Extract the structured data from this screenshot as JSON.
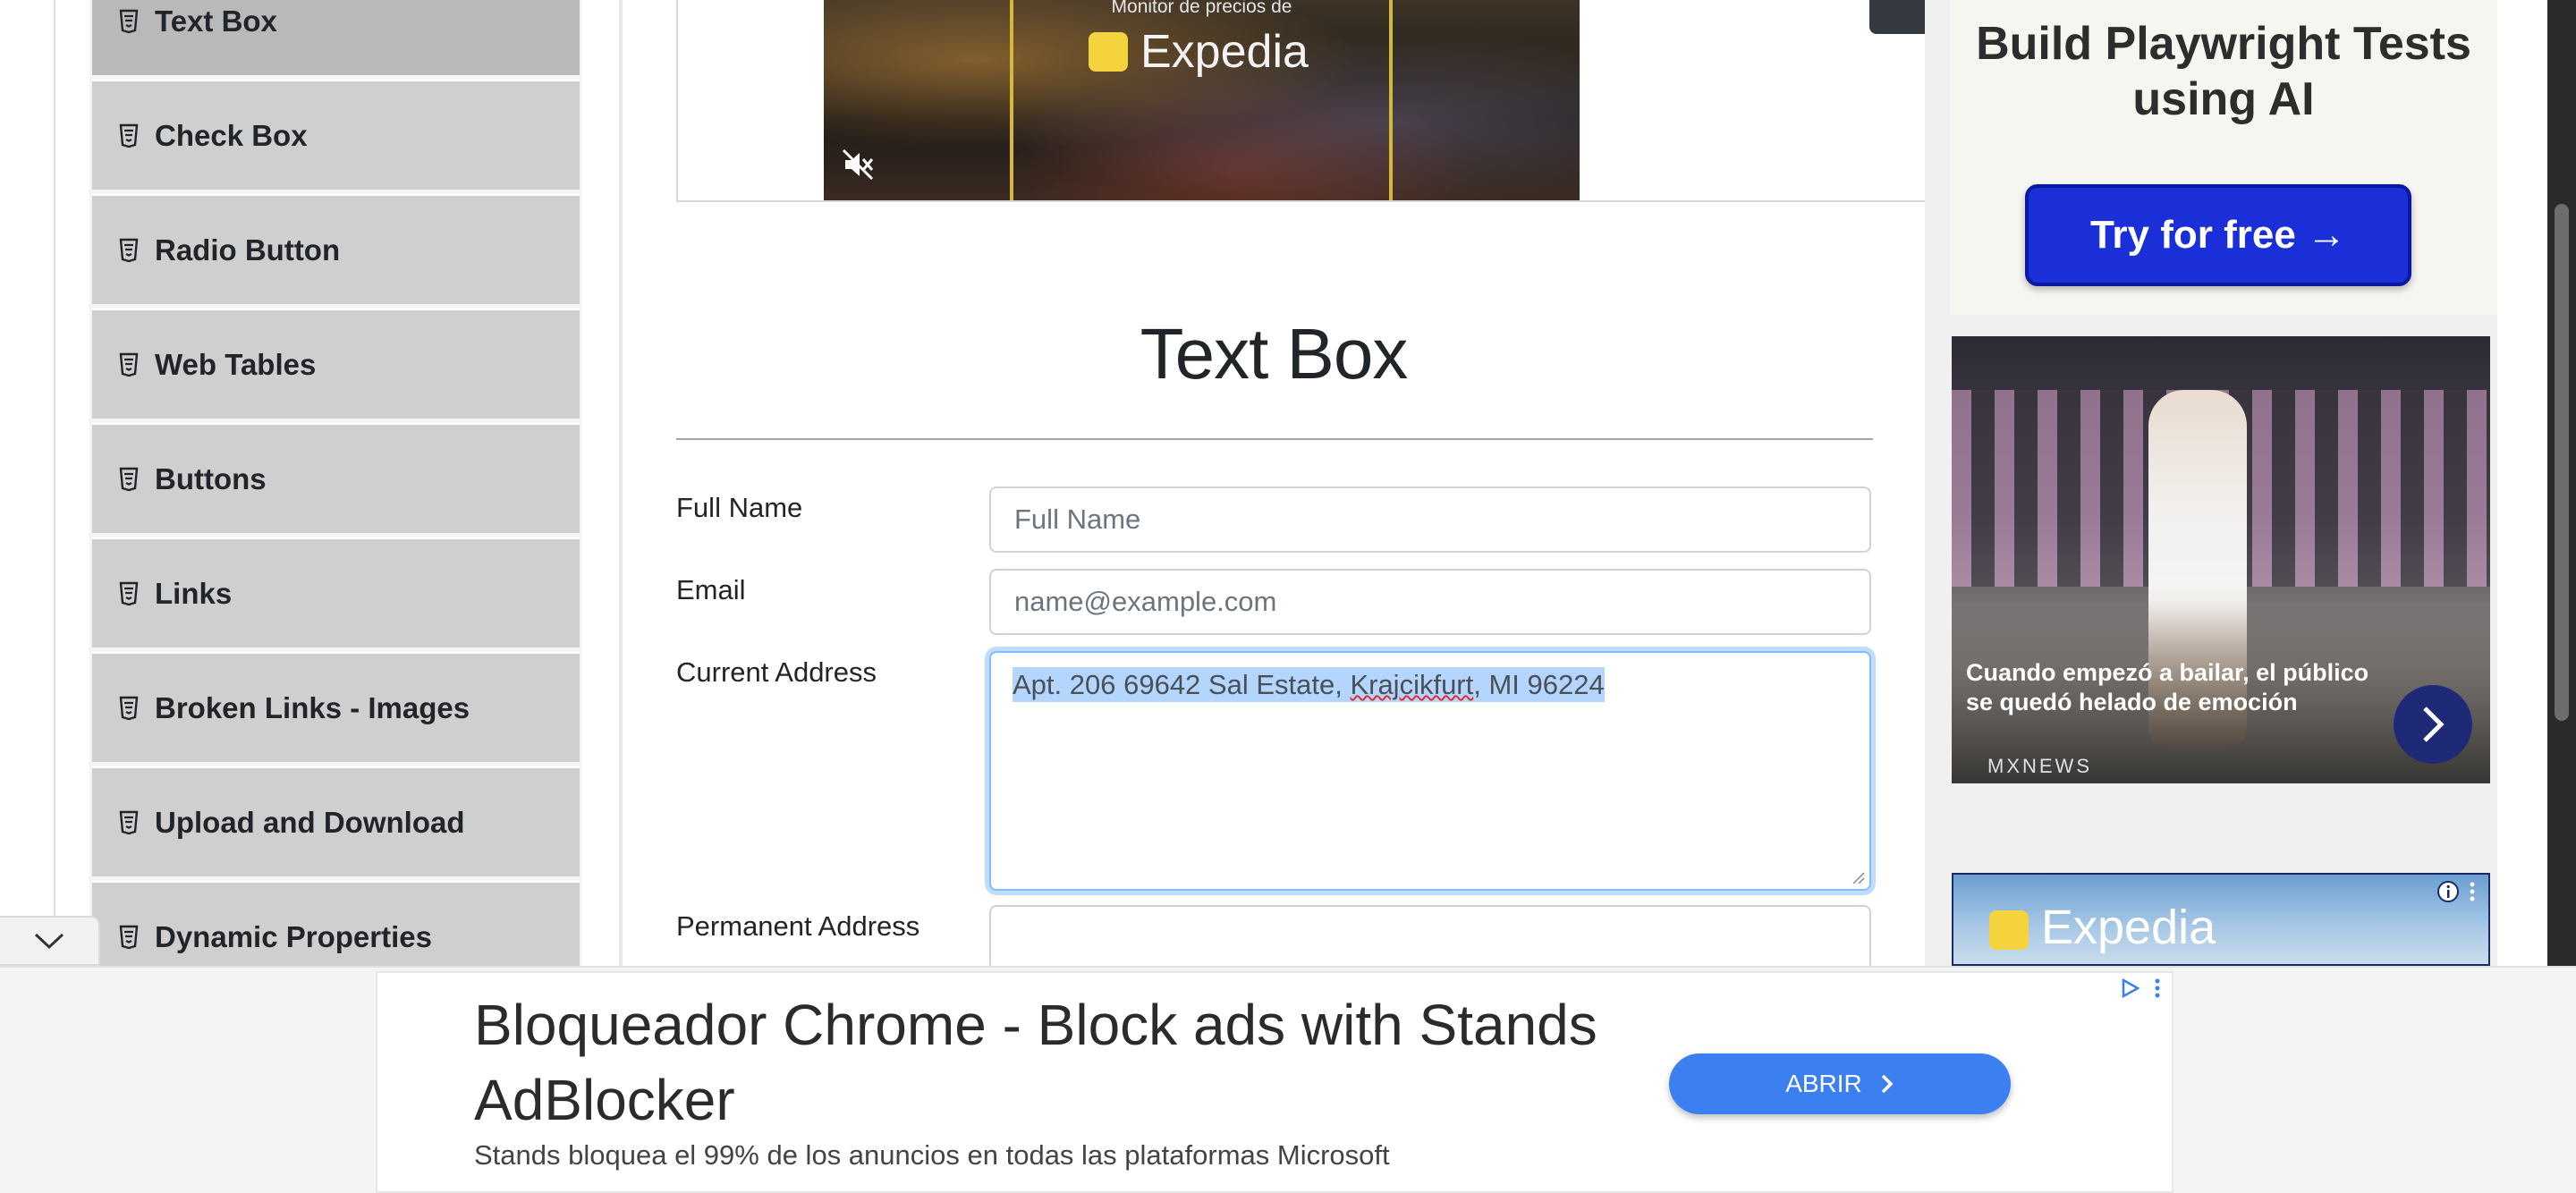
{
  "sidebar": {
    "items": [
      {
        "label": "Text Box",
        "active": true
      },
      {
        "label": "Check Box"
      },
      {
        "label": "Radio Button"
      },
      {
        "label": "Web Tables"
      },
      {
        "label": "Buttons"
      },
      {
        "label": "Links"
      },
      {
        "label": "Broken Links - Images"
      },
      {
        "label": "Upload and Download"
      },
      {
        "label": "Dynamic Properties"
      }
    ],
    "item_icon": "html5-file-icon",
    "collapse_icon": "chevron-down-icon"
  },
  "video_ad": {
    "top_text": "Monitor de precios de",
    "brand": "Expedia",
    "mute_icon": "muted-speaker-icon"
  },
  "main": {
    "header": "Text Box",
    "fields": {
      "full_name": {
        "label": "Full Name",
        "placeholder": "Full Name"
      },
      "email": {
        "label": "Email",
        "placeholder": "name@example.com"
      },
      "current_address": {
        "label": "Current Address",
        "value_part1": "Apt. 206 69642 Sal Estate, ",
        "value_misspelled": "Krajcikfurt",
        "value_part2": ", MI 96224"
      },
      "permanent_address": {
        "label": "Permanent Address"
      }
    }
  },
  "right_ads": {
    "ad1": {
      "title": "Build Playwright Tests using AI",
      "button": "Try for free →"
    },
    "ad2": {
      "caption": "Cuando empezó a bailar, el público se quedó helado de emoción",
      "source": "MXNEWS",
      "next_icon": "chevron-right-icon"
    },
    "ad3": {
      "brand": "Expedia"
    }
  },
  "bottom_banner": {
    "headline": "Bloqueador Chrome - Block ads with Stands AdBlocker",
    "subtext": "Stands bloquea el 99% de los anuncios en todas las plataformas Microsoft",
    "cta": "ABRIR"
  },
  "colors": {
    "sidebar_item": "#cfcfcf",
    "sidebar_active": "#b9b9b9",
    "focus_border": "#80bdff",
    "selection": "#b4d5fe",
    "cta_blue": "#3b7ff0",
    "ad_button_blue": "#1a2fd8"
  }
}
